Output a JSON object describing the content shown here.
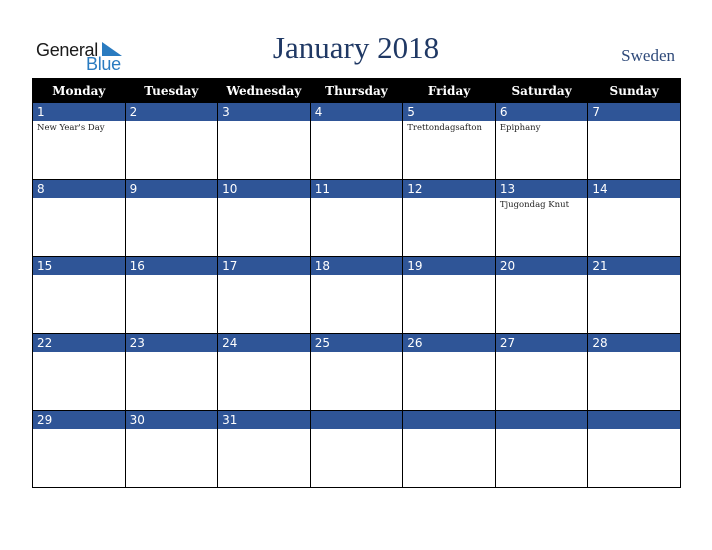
{
  "logo": {
    "line1": "General",
    "line2": "Blue"
  },
  "title": "January 2018",
  "country": "Sweden",
  "colors": {
    "header_bg": "#000000",
    "date_band": "#2f5597",
    "title": "#1f3864",
    "logo_blue": "#2a7bc0"
  },
  "weekdays": [
    "Monday",
    "Tuesday",
    "Wednesday",
    "Thursday",
    "Friday",
    "Saturday",
    "Sunday"
  ],
  "weeks": [
    [
      {
        "day": "1",
        "event": "New Year's Day"
      },
      {
        "day": "2",
        "event": ""
      },
      {
        "day": "3",
        "event": ""
      },
      {
        "day": "4",
        "event": ""
      },
      {
        "day": "5",
        "event": "Trettondagsafton"
      },
      {
        "day": "6",
        "event": "Epiphany"
      },
      {
        "day": "7",
        "event": ""
      }
    ],
    [
      {
        "day": "8",
        "event": ""
      },
      {
        "day": "9",
        "event": ""
      },
      {
        "day": "10",
        "event": ""
      },
      {
        "day": "11",
        "event": ""
      },
      {
        "day": "12",
        "event": ""
      },
      {
        "day": "13",
        "event": "Tjugondag Knut"
      },
      {
        "day": "14",
        "event": ""
      }
    ],
    [
      {
        "day": "15",
        "event": ""
      },
      {
        "day": "16",
        "event": ""
      },
      {
        "day": "17",
        "event": ""
      },
      {
        "day": "18",
        "event": ""
      },
      {
        "day": "19",
        "event": ""
      },
      {
        "day": "20",
        "event": ""
      },
      {
        "day": "21",
        "event": ""
      }
    ],
    [
      {
        "day": "22",
        "event": ""
      },
      {
        "day": "23",
        "event": ""
      },
      {
        "day": "24",
        "event": ""
      },
      {
        "day": "25",
        "event": ""
      },
      {
        "day": "26",
        "event": ""
      },
      {
        "day": "27",
        "event": ""
      },
      {
        "day": "28",
        "event": ""
      }
    ],
    [
      {
        "day": "29",
        "event": ""
      },
      {
        "day": "30",
        "event": ""
      },
      {
        "day": "31",
        "event": ""
      },
      {
        "day": "",
        "event": ""
      },
      {
        "day": "",
        "event": ""
      },
      {
        "day": "",
        "event": ""
      },
      {
        "day": "",
        "event": ""
      }
    ]
  ]
}
